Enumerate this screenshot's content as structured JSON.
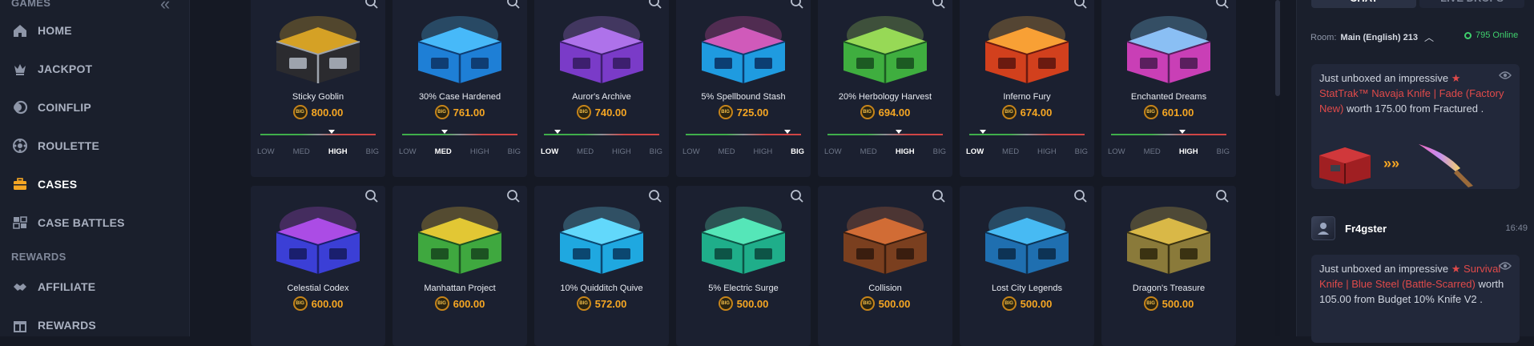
{
  "sidebar": {
    "section_games": "GAMES",
    "section_rewards": "REWARDS",
    "collapse_icon": "double-chevron-left-icon",
    "items": [
      {
        "label": "HOME",
        "icon": "house-icon"
      },
      {
        "label": "JACKPOT",
        "icon": "crown-icon"
      },
      {
        "label": "COINFLIP",
        "icon": "coin-icon"
      },
      {
        "label": "ROULETTE",
        "icon": "roulette-icon"
      },
      {
        "label": "CASES",
        "icon": "case-icon",
        "active": true
      },
      {
        "label": "CASE BATTLES",
        "icon": "battle-icon"
      },
      {
        "label": "AFFILIATE",
        "icon": "handshake-icon"
      },
      {
        "label": "REWARDS",
        "icon": "gift-icon"
      }
    ]
  },
  "risk_labels": [
    "LOW",
    "MED",
    "HIGH",
    "BIG"
  ],
  "cases": [
    {
      "name": "Sticky Goblin",
      "price": "800.00",
      "risk": "HIGH",
      "marker": 0.62,
      "palette": [
        "#2b2b2f",
        "#f3b623",
        "#9da3ad"
      ]
    },
    {
      "name": "30% Case Hardened",
      "price": "761.00",
      "risk": "MED",
      "marker": 0.37,
      "palette": [
        "#1e7fd6",
        "#4fc3ff",
        "#0f3d73"
      ]
    },
    {
      "name": "Auror's Archive",
      "price": "740.00",
      "risk": "LOW",
      "marker": 0.12,
      "palette": [
        "#7a3bc8",
        "#b77df0",
        "#3d1f6e"
      ]
    },
    {
      "name": "5% Spellbound Stash",
      "price": "725.00",
      "risk": "BIG",
      "marker": 0.88,
      "palette": [
        "#1f9be0",
        "#f04fb3",
        "#0c3e72"
      ]
    },
    {
      "name": "20% Herbology Harvest",
      "price": "694.00",
      "risk": "HIGH",
      "marker": 0.62,
      "palette": [
        "#3fae3f",
        "#a7e05a",
        "#1c5a22"
      ]
    },
    {
      "name": "Inferno Fury",
      "price": "674.00",
      "risk": "LOW",
      "marker": 0.12,
      "palette": [
        "#d2401d",
        "#ffb23a",
        "#6b1a10"
      ]
    },
    {
      "name": "Enchanted Dreams",
      "price": "601.00",
      "risk": "HIGH",
      "marker": 0.62,
      "palette": [
        "#c93fb6",
        "#7fd6ff",
        "#5a1f5e"
      ]
    },
    {
      "name": "Celestial Codex",
      "price": "600.00",
      "risk": "",
      "marker": null,
      "palette": [
        "#3b3fd6",
        "#c04fe8",
        "#1a1f6e"
      ]
    },
    {
      "name": "Manhattan Project",
      "price": "600.00",
      "risk": "",
      "marker": null,
      "palette": [
        "#3fa83f",
        "#ffcc33",
        "#1c5222"
      ]
    },
    {
      "name": "10% Quidditch Quive",
      "price": "572.00",
      "risk": "",
      "marker": null,
      "palette": [
        "#1fa8e0",
        "#6ee0ff",
        "#0b4770"
      ]
    },
    {
      "name": "5% Electric Surge",
      "price": "500.00",
      "risk": "",
      "marker": null,
      "palette": [
        "#1fae8a",
        "#5ff0c0",
        "#0d5446"
      ]
    },
    {
      "name": "Collision",
      "price": "500.00",
      "risk": "",
      "marker": null,
      "palette": [
        "#7a3f1f",
        "#e0743a",
        "#3a1d0f"
      ]
    },
    {
      "name": "Lost City Legends",
      "price": "500.00",
      "risk": "",
      "marker": null,
      "palette": [
        "#1f6fb0",
        "#4fc8ff",
        "#0d3355"
      ]
    },
    {
      "name": "Dragon's Treasure",
      "price": "500.00",
      "risk": "",
      "marker": null,
      "palette": [
        "#8a7a3a",
        "#e6c34a",
        "#3a3212"
      ]
    }
  ],
  "chat": {
    "tab_chat": "CHAT",
    "tab_live": "LIVE DROPS",
    "room_label": "Room:",
    "room_name": "Main (English) 213",
    "online": "795 Online",
    "messages": [
      {
        "prefix": "Just unboxed an impressive ",
        "star": "★",
        "item": "StatTrak™ Navaja Knife | Fade (Factory New)",
        "mid": " worth 175.00 from ",
        "case": "Fractured ."
      },
      {
        "user": "Fr4gster",
        "time": "16:49",
        "prefix": "Just unboxed an impressive ",
        "star": "★",
        "item": "Survival Knife | Blue Steel (Battle-Scarred)",
        "mid": " worth 105.00 from ",
        "case": "Budget 10% Knife V2 ."
      }
    ],
    "arrows": "»»"
  },
  "colors": {
    "accent": "#f5a623",
    "bg": "#151924",
    "card": "#1b2030",
    "danger": "#e04a4a",
    "online": "#3fd06d"
  }
}
